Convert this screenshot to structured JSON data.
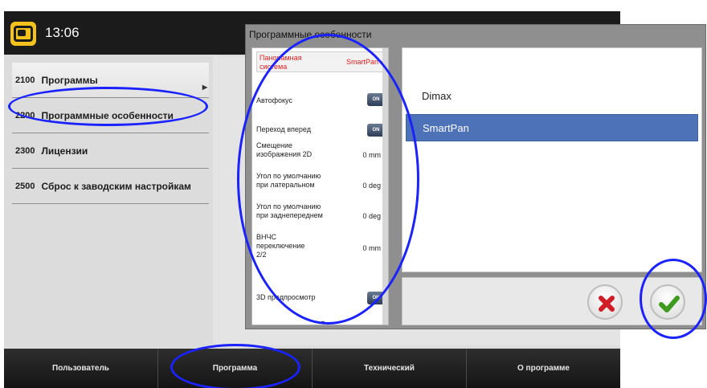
{
  "topbar": {
    "time": "13:06",
    "logo_icon": "device-logo-icon"
  },
  "menu": {
    "items": [
      {
        "code": "2100",
        "label": "Программы"
      },
      {
        "code": "2200",
        "label": "Программные особенности"
      },
      {
        "code": "2300",
        "label": "Лицензии"
      },
      {
        "code": "2500",
        "label": "Сброс к заводским настройкам"
      }
    ]
  },
  "bottom_tabs": [
    "Пользователь",
    "Программа",
    "Технический",
    "О программе"
  ],
  "dialog": {
    "title": "Программные особенности",
    "options": [
      {
        "name": "Панорамная система",
        "value": "SmartPan ▸"
      },
      {
        "name": "Автофокус",
        "toggle": "ON"
      },
      {
        "name": "Переход вперед",
        "toggle": "ON"
      },
      {
        "name": "Смещение изображения 2D",
        "value": "0 mm ▸"
      },
      {
        "name": "Угол по умолчанию при латеральном",
        "value": "0 deg ▸"
      },
      {
        "name": "Угол по умолчанию при заднепереднем",
        "value": "0 deg ▸"
      },
      {
        "name": "ВНЧС переключение 2/2",
        "value": "0 mm ▸"
      },
      {
        "name": "3D предпросмотр",
        "toggle": "ON"
      }
    ],
    "choices": [
      "Dimax",
      "SmartPan"
    ],
    "selected_choice": "SmartPan",
    "scroll_down_glyph": "▾"
  },
  "colors": {
    "accent": "#4e72b8",
    "annotation": "#1a22ff",
    "highlight_text": "#e02020"
  }
}
